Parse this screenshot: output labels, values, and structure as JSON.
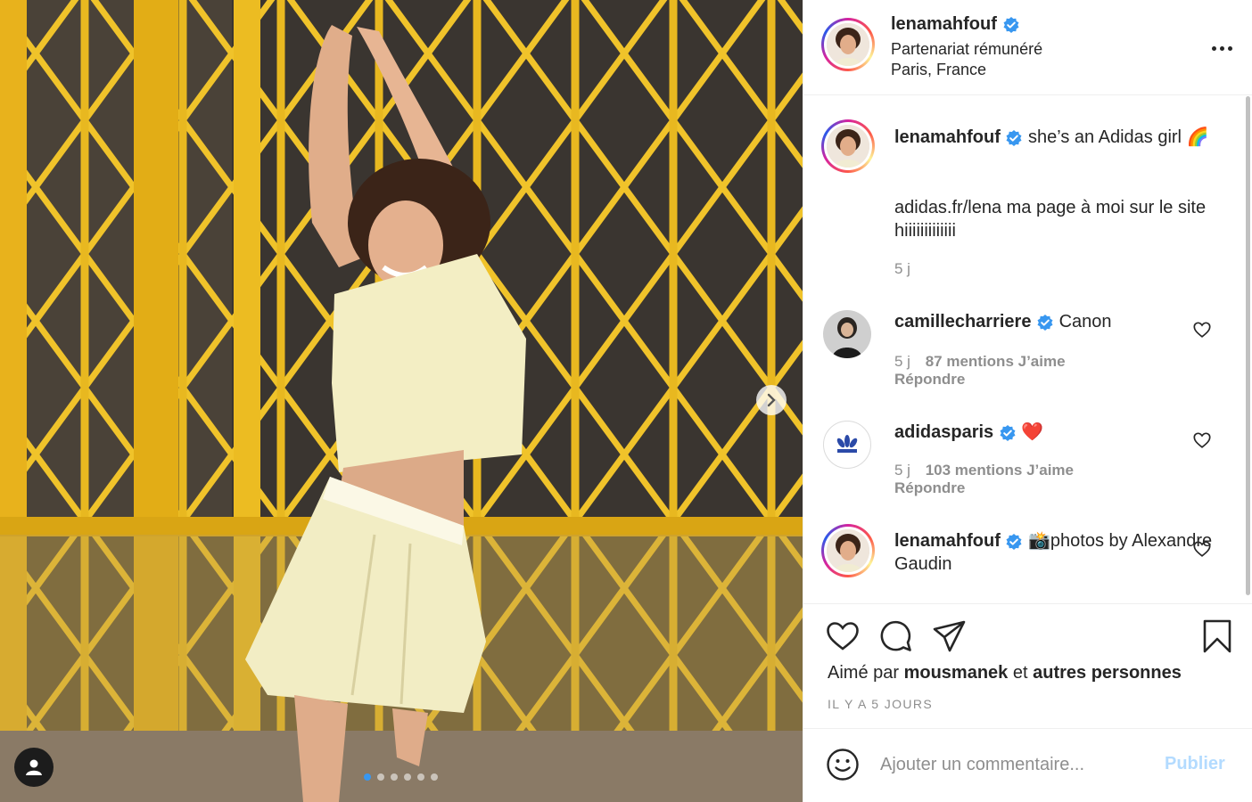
{
  "post": {
    "username": "lenamahfouf",
    "partnership": "Partenariat rémunéré",
    "location": "Paris, France",
    "caption_text": "she’s an Adidas girl 🌈",
    "caption_body": "adidas.fr/lena ma page à moi sur le site hiiiiiiiiiiiii",
    "caption_time": "5 j"
  },
  "comments": [
    {
      "username": "camillecharriere",
      "text": "Canon",
      "time": "5 j",
      "likes": "87 mentions J’aime",
      "reply": "Répondre"
    },
    {
      "username": "adidasparis",
      "text": "❤️",
      "time": "5 j",
      "likes": "103 mentions J’aime",
      "reply": "Répondre"
    },
    {
      "username": "lenamahfouf",
      "text": "📸photos by Alexandre Gaudin"
    }
  ],
  "likes": {
    "prefix": "Aimé par",
    "user": "mousmanek",
    "middle": "et",
    "others": "autres personnes"
  },
  "timestamp": "IL Y A 5 JOURS",
  "composer": {
    "placeholder": "Ajouter un commentaire...",
    "publish_label": "Publier"
  },
  "carousel": {
    "count": 6,
    "active_index": 0
  },
  "colors": {
    "verified": "#3897f0",
    "heart_red": "#ed4956",
    "publish_disabled": "#b3dbff",
    "muted": "#8e8e8e"
  },
  "icons": [
    "chevron-right-icon",
    "user-tag-icon",
    "more-icon",
    "verified-icon",
    "heart-icon",
    "comment-icon",
    "share-icon",
    "bookmark-icon",
    "emoji-icon"
  ]
}
